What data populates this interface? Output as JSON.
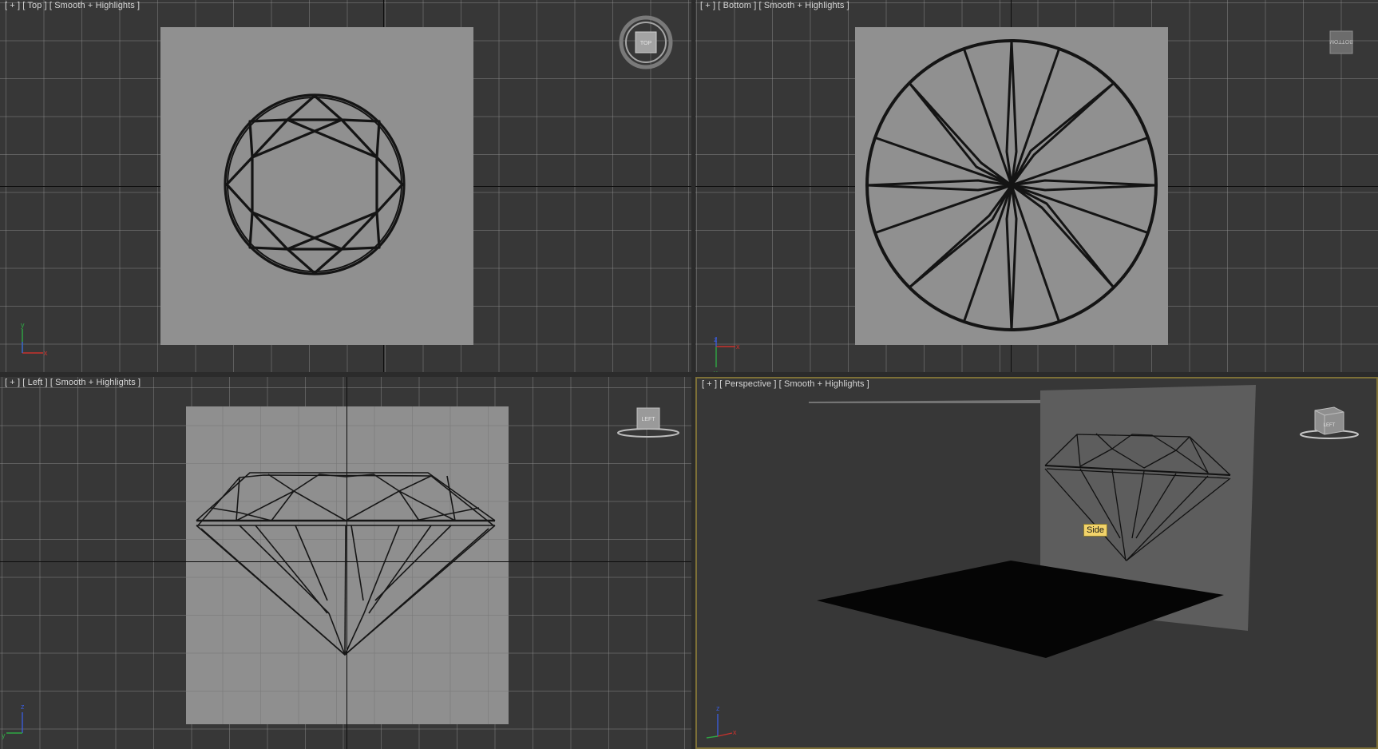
{
  "viewports": {
    "top": {
      "label": "[ + ] [ Top ] [ Smooth + Highlights ]",
      "cube_text": "TOP"
    },
    "bottom": {
      "label": "[ + ] [ Bottom ] [ Smooth + Highlights ]",
      "cube_text": "BOTTOM"
    },
    "left": {
      "label": "[ + ] [ Left ] [ Smooth + Highlights ]",
      "cube_text": "LEFT"
    },
    "perspective": {
      "label": "[ + ] [ Perspective ] [ Smooth + Highlights ]",
      "cube_text": "LEFT",
      "tooltip": "Side"
    }
  },
  "axes": {
    "top": [
      "x",
      "y"
    ],
    "bottom": [
      "x",
      "z",
      "y"
    ],
    "left": [
      "y",
      "z"
    ],
    "perspective": [
      "x",
      "z"
    ]
  },
  "colors": {
    "viewport_bg": "#373737",
    "grid_line": "#969696",
    "plane": "#909090",
    "active_border": "#7d7037",
    "tooltip_bg": "#f2d36a",
    "axis_x": "#c8322d",
    "axis_y": "#2fa844",
    "axis_z": "#3a5bd6"
  }
}
